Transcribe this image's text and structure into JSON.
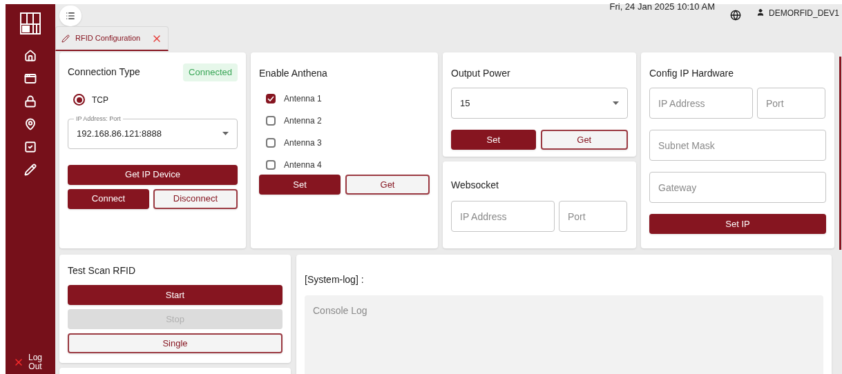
{
  "header": {
    "datetime": "Fri, 24 Jan 2025 10:10 AM",
    "user": "DEMORFID_DEV1"
  },
  "sidebar": {
    "items": [
      {
        "kind": "home"
      },
      {
        "kind": "window"
      },
      {
        "kind": "lock"
      },
      {
        "kind": "pin"
      },
      {
        "kind": "check"
      },
      {
        "kind": "pencil"
      }
    ],
    "logout": "Log Out"
  },
  "tabs": [
    {
      "label": "RFID Configuration",
      "selected": true
    }
  ],
  "connection": {
    "title": "Connection Type",
    "status": "Connected",
    "radios": [
      {
        "label": "TCP",
        "selected": true
      }
    ],
    "ip_field": {
      "label": "IP Address: Port",
      "value": "192.168.86.121:8888"
    },
    "buttons": [
      {
        "label": "Get IP Device",
        "kind": "primary"
      },
      {
        "label": "Connect",
        "kind": "primary"
      },
      {
        "label": "Disconnect",
        "kind": "outline"
      }
    ]
  },
  "antenna": {
    "title": "Enable Anthena",
    "items": [
      {
        "label": "Antenna 1",
        "checked": true
      },
      {
        "label": "Antenna 2",
        "checked": false
      },
      {
        "label": "Antenna 3",
        "checked": false
      },
      {
        "label": "Antenna 4",
        "checked": false
      }
    ],
    "buttons": [
      {
        "label": "Set",
        "kind": "primary"
      },
      {
        "label": "Get",
        "kind": "outline"
      }
    ]
  },
  "output_power": {
    "title": "Output Power",
    "value": "15",
    "buttons": [
      {
        "label": "Set",
        "kind": "primary"
      },
      {
        "label": "Get",
        "kind": "outline"
      }
    ]
  },
  "websocket": {
    "title": "Websocket",
    "fields": [
      {
        "placeholder": "IP Address"
      },
      {
        "placeholder": "Port"
      }
    ]
  },
  "config_ip": {
    "title": "Config IP Hardware",
    "fields": [
      {
        "placeholder": "IP Address"
      },
      {
        "placeholder": "Port"
      },
      {
        "placeholder": "Subnet Mask"
      },
      {
        "placeholder": "Gateway"
      }
    ],
    "button": "Set IP"
  },
  "test_scan": {
    "title": "Test Scan RFID",
    "buttons": [
      {
        "label": "Start",
        "kind": "primary"
      },
      {
        "label": "Stop",
        "kind": "disabled"
      },
      {
        "label": "Single",
        "kind": "outline"
      }
    ]
  },
  "system_log": {
    "title": "[System-log] :",
    "placeholder": "Console Log"
  }
}
